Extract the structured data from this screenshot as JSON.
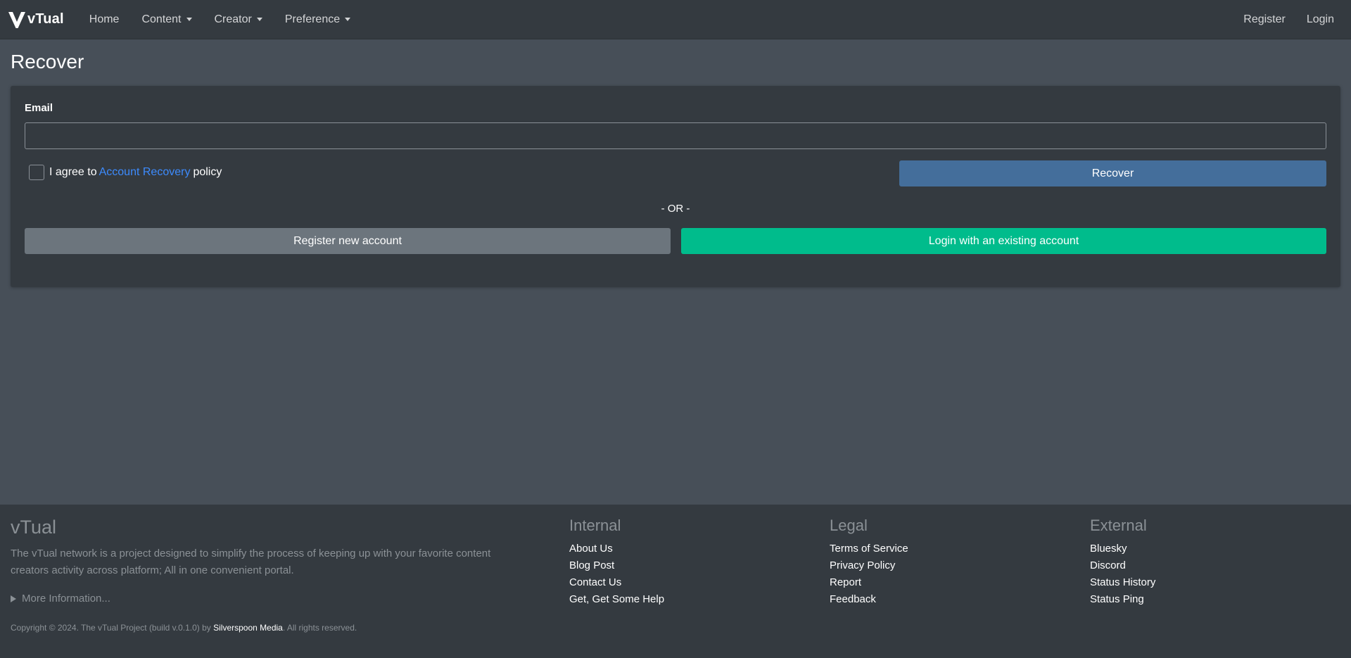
{
  "nav": {
    "brand": "vTual",
    "items": [
      {
        "label": "Home",
        "dropdown": false
      },
      {
        "label": "Content",
        "dropdown": true
      },
      {
        "label": "Creator",
        "dropdown": true
      },
      {
        "label": "Preference",
        "dropdown": true
      }
    ],
    "right": [
      "Register",
      "Login"
    ]
  },
  "page": {
    "title": "Recover"
  },
  "form": {
    "email_label": "Email",
    "email_value": "",
    "agree_prefix": "I agree to",
    "agree_link": "Account Recovery",
    "agree_suffix": "policy",
    "checkbox_checked": false,
    "recover_button": "Recover",
    "or_text": "- OR -",
    "register_button": "Register new account",
    "login_button": "Login with an existing account"
  },
  "footer": {
    "brand": "vTual",
    "description": "The vTual network is a project designed to simplify the process of keeping up with your favorite content creators activity across platform; All in one convenient portal.",
    "more_info": "More Information...",
    "copyright_prefix": "Copyright © 2024. The vTual Project (build v.0.1.0) by",
    "copyright_company": "Silverspoon Media",
    "copyright_suffix": ". All rights reserved.",
    "internal": {
      "title": "Internal",
      "links": [
        "About Us",
        "Blog Post",
        "Contact Us",
        "Get, Get Some Help"
      ]
    },
    "legal": {
      "title": "Legal",
      "links": [
        "Terms of Service",
        "Privacy Policy",
        "Report",
        "Feedback"
      ]
    },
    "external": {
      "title": "External",
      "links": [
        "Bluesky",
        "Discord",
        "Status History",
        "Status Ping"
      ]
    }
  },
  "colors": {
    "navbar": "#343a40",
    "page_background": "#474f58",
    "card": "#343a40",
    "recover_button": "#446e9b",
    "register_button": "#6c757d",
    "login_button": "#00bc8c",
    "link": "#3d8bfd"
  },
  "icons": {
    "logo": "v-logo-icon",
    "caret": "caret-down-icon",
    "disclosure": "triangle-right-icon"
  }
}
